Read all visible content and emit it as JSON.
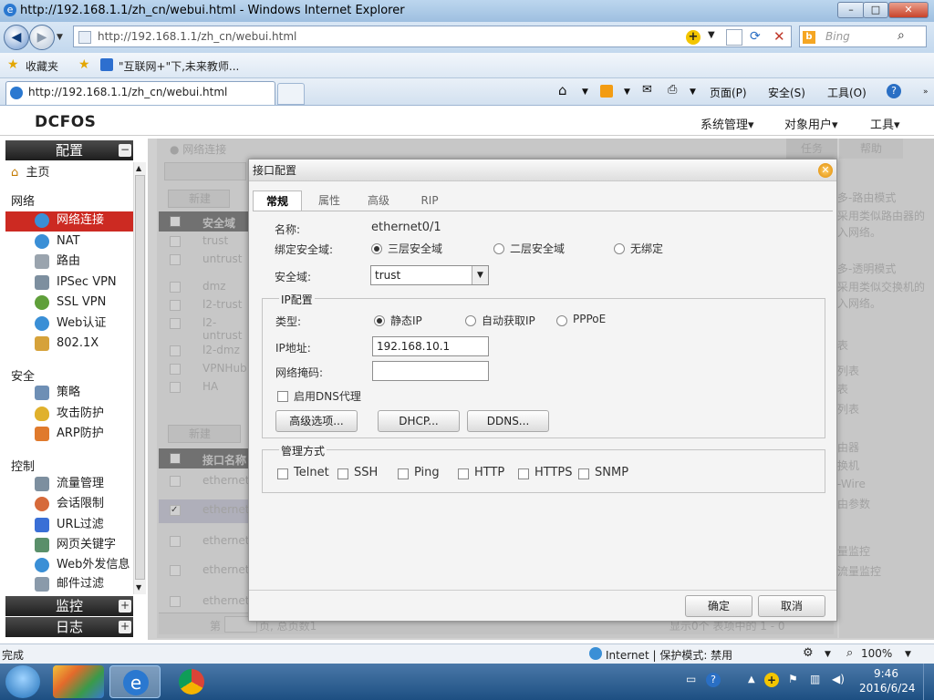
{
  "window": {
    "title": "http://192.168.1.1/zh_cn/webui.html - Windows Internet Explorer"
  },
  "address": {
    "url": "http://192.168.1.1/zh_cn/webui.html",
    "search_placeholder": "Bing"
  },
  "favorites": {
    "label": "收藏夹",
    "link": "\"互联网+\"下,未来教师..."
  },
  "tab": {
    "title": "http://192.168.1.1/zh_cn/webui.html"
  },
  "commandbar": {
    "page": "页面(P)",
    "safety": "安全(S)",
    "tools": "工具(O)"
  },
  "app": {
    "logo": "DCFOS",
    "menu": {
      "system": "系统管理",
      "objects": "对象用户",
      "tools": "工具"
    }
  },
  "sidebar": {
    "config": "配置",
    "home": "主页",
    "network_group": "网络",
    "network_items": [
      "网络连接",
      "NAT",
      "路由",
      "IPSec VPN",
      "SSL VPN",
      "Web认证",
      "802.1X"
    ],
    "security_group": "安全",
    "security_items": [
      "策略",
      "攻击防护",
      "ARP防护"
    ],
    "control_group": "控制",
    "control_items": [
      "流量管理",
      "会话限制",
      "URL过滤",
      "网页关键字",
      "Web外发信息",
      "邮件过滤"
    ],
    "monitor": "监控",
    "log": "日志"
  },
  "background": {
    "breadcrumb": "网络连接",
    "right_tabs": [
      "任务",
      "帮助"
    ],
    "toolbar_new": "新建",
    "zone_header": "安全域",
    "zones": [
      "trust",
      "untrust",
      "dmz",
      "l2-trust",
      "l2-untrust",
      "l2-dmz",
      "VPNHub",
      "HA"
    ],
    "iface_new": "新建",
    "iface_header": "接口名称",
    "ifaces": [
      "ethernet",
      "ethernet",
      "ethernet",
      "ethernet",
      "ethernet"
    ],
    "pager_info": "显示0个 表项中的 1 - 0",
    "pager_prefix": "第",
    "pager_suffix": "页, 总页数1",
    "help_lines": [
      "多-路由模式",
      "采用类似路由器的",
      "入网络。",
      "多-透明模式",
      "采用类似交换机的",
      "入网络。",
      "表",
      "列表",
      "表",
      "列表",
      "由器",
      "换机",
      "-Wire",
      "由参数",
      "量监控",
      "流量监控"
    ]
  },
  "dialog": {
    "title": "接口配置",
    "tabs": [
      "常规",
      "属性",
      "高级",
      "RIP"
    ],
    "name_label": "名称:",
    "name_value": "ethernet0/1",
    "bind_label": "绑定安全域:",
    "bind_options": [
      "三层安全域",
      "二层安全域",
      "无绑定"
    ],
    "zone_label": "安全域:",
    "zone_value": "trust",
    "ip_section": "IP配置",
    "type_label": "类型:",
    "type_options": [
      "静态IP",
      "自动获取IP",
      "PPPoE"
    ],
    "ip_label": "IP地址:",
    "ip_value": "192.168.10.1",
    "mask_label": "网络掩码:",
    "mask_value": "",
    "dns_proxy": "启用DNS代理",
    "btn_advanced": "高级选项...",
    "btn_dhcp": "DHCP...",
    "btn_ddns": "DDNS...",
    "mgmt_section": "管理方式",
    "mgmt_options": [
      "Telnet",
      "SSH",
      "Ping",
      "HTTP",
      "HTTPS",
      "SNMP"
    ],
    "ok": "确定",
    "cancel": "取消"
  },
  "status": {
    "left": "完成",
    "zone": "Internet | 保护模式: 禁用",
    "zoom": "100%"
  },
  "taskbar": {
    "time": "9:46",
    "date": "2016/6/24"
  }
}
